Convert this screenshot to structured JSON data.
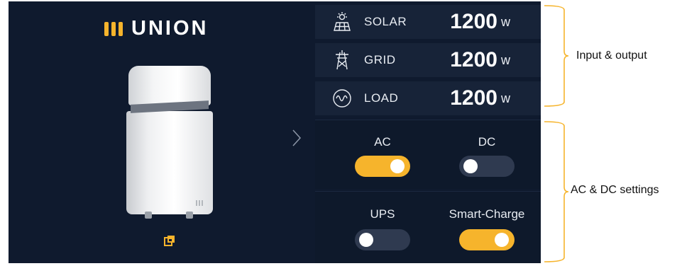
{
  "brand": {
    "name": "UNION"
  },
  "io": [
    {
      "icon": "solar-panel-icon",
      "label": "SOLAR",
      "value": "1200",
      "unit": "w"
    },
    {
      "icon": "power-tower-icon",
      "label": "GRID",
      "value": "1200",
      "unit": "w"
    },
    {
      "icon": "load-wave-icon",
      "label": "LOAD",
      "value": "1200",
      "unit": "w"
    }
  ],
  "toggles": {
    "ac": {
      "label": "AC",
      "state": "on"
    },
    "dc": {
      "label": "DC",
      "state": "off"
    },
    "ups": {
      "label": "UPS",
      "state": "off"
    },
    "smart_charge": {
      "label": "Smart-Charge",
      "state": "on"
    }
  },
  "annotations": {
    "input_output": "Input & output",
    "ac_dc_settings": "AC & DC settings"
  },
  "colors": {
    "accent": "#f6b42c",
    "background": "#0f1a2e",
    "panel": "#172338",
    "toggle_off": "#2f3a50"
  }
}
